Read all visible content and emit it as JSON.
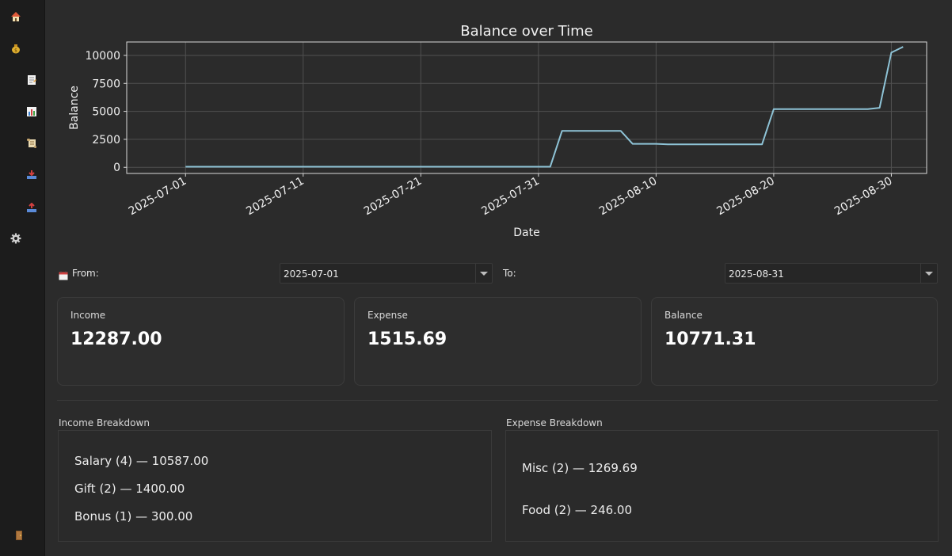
{
  "sidebar": {
    "items": [
      {
        "name": "home-icon",
        "glyph": "🏠"
      },
      {
        "name": "money-bag-icon",
        "glyph": "💰"
      },
      {
        "name": "notes-icon",
        "glyph": "📝"
      },
      {
        "name": "bar-chart-icon",
        "glyph": "📊"
      },
      {
        "name": "scroll-icon",
        "glyph": "📜"
      },
      {
        "name": "inbox-tray-icon",
        "glyph": "📥"
      },
      {
        "name": "outbox-tray-icon",
        "glyph": "📤"
      },
      {
        "name": "gear-icon",
        "glyph": "⚙"
      },
      {
        "name": "door-icon",
        "glyph": "🚪"
      }
    ]
  },
  "chart_data": {
    "type": "line",
    "title": "Balance over Time",
    "xlabel": "Date",
    "ylabel": "Balance",
    "x_ticks": [
      "2025-07-01",
      "2025-07-11",
      "2025-07-21",
      "2025-07-31",
      "2025-08-10",
      "2025-08-20",
      "2025-08-30"
    ],
    "y_ticks": [
      0,
      2500,
      5000,
      7500,
      10000
    ],
    "xlim": [
      "2025-06-26",
      "2025-09-02"
    ],
    "ylim": [
      -550,
      11200
    ],
    "grid": true,
    "line_color": "#8ec3d6",
    "series": [
      {
        "x": [
          "2025-07-01",
          "2025-08-01",
          "2025-08-02",
          "2025-08-07",
          "2025-08-08",
          "2025-08-10",
          "2025-08-11",
          "2025-08-19",
          "2025-08-20",
          "2025-08-28",
          "2025-08-29",
          "2025-08-30",
          "2025-08-31"
        ],
        "y": [
          50,
          50,
          3250,
          3250,
          2100,
          2100,
          2050,
          2050,
          5200,
          5200,
          5320,
          10250,
          10771.31
        ]
      }
    ]
  },
  "filters": {
    "from_label": "From:",
    "from_value": "2025-07-01",
    "to_label": "To:",
    "to_value": "2025-08-31"
  },
  "summary": {
    "income_label": "Income",
    "income_value": "12287.00",
    "expense_label": "Expense",
    "expense_value": "1515.69",
    "balance_label": "Balance",
    "balance_value": "10771.31"
  },
  "income_breakdown": {
    "title": "Income Breakdown",
    "items": [
      "Salary (4) — 10587.00",
      "Gift (2) — 1400.00",
      "Bonus (1) — 300.00"
    ]
  },
  "expense_breakdown": {
    "title": "Expense Breakdown",
    "items": [
      "Misc (2) — 1269.69",
      "Food (2) — 246.00"
    ]
  }
}
